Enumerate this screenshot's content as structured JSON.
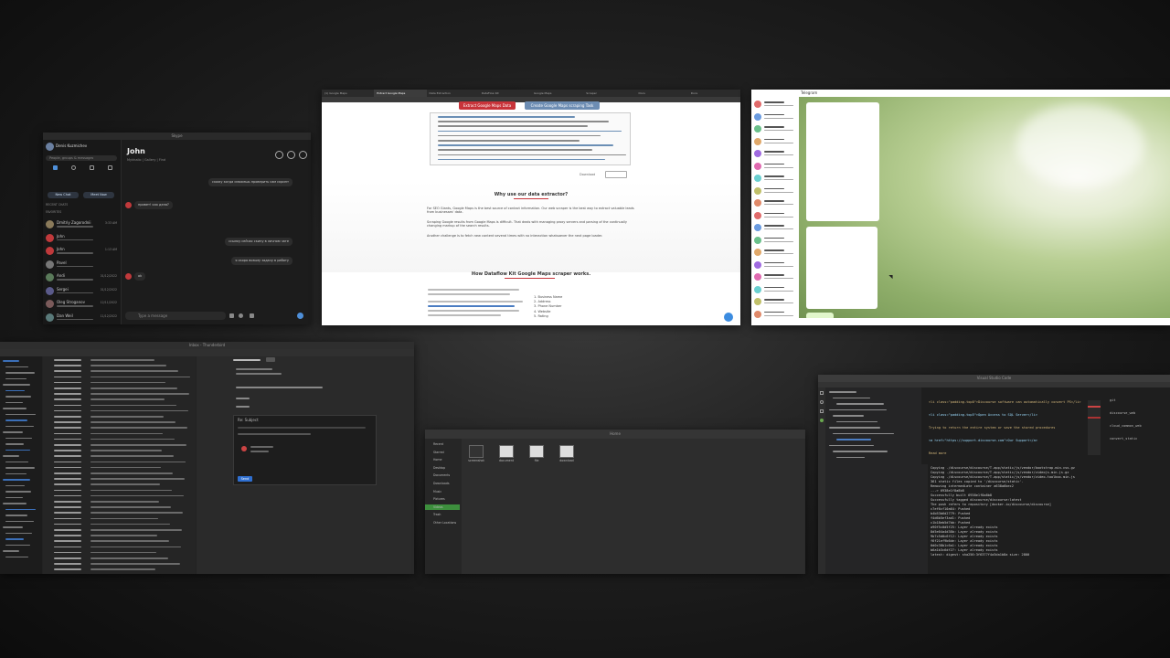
{
  "skype": {
    "title": "Skype",
    "user": "Denis Kuzmichev",
    "search_placeholder": "People, groups & messages",
    "nav": [
      "Chats",
      "Calls",
      "Contacts",
      "Notifications"
    ],
    "buttons": [
      "New Chat",
      "Meet Now"
    ],
    "section_recent": "RECENT CHATS",
    "section_favorites": "FAVORITES",
    "contacts": [
      {
        "name": "Dmitriy Zagorodnii",
        "time": "3:33 AM",
        "color": "#8a7a5a"
      },
      {
        "name": "John",
        "time": "",
        "color": "#c0393b"
      },
      {
        "name": "John",
        "time": "1:13 AM",
        "color": "#c0393b"
      },
      {
        "name": "Pavel",
        "time": "",
        "color": "#777"
      },
      {
        "name": "Andi",
        "time": "01/12/2022",
        "color": "#5a7a5a"
      },
      {
        "name": "Sergei",
        "time": "01/12/2022",
        "color": "#5a5a8a"
      },
      {
        "name": "Oleg Stroganov",
        "time": "12/11/2022",
        "color": "#7a5a5a"
      },
      {
        "name": "Dan Weil",
        "time": "11/12/2022",
        "color": "#5a7a7a"
      },
      {
        "name": "Maria",
        "time": "10/12/2022",
        "color": "#6a5a7a"
      },
      {
        "name": "DK",
        "time": "",
        "color": "#555"
      }
    ],
    "chat_title": "John",
    "chat_meta": "Mykhailo | Gallery | Find",
    "message_placeholder": "Type a message",
    "messages": [
      {
        "side": "right",
        "text": "скажу когда сможешь проверить сам скрипт"
      },
      {
        "side": "left",
        "text": "привет! как дела?"
      },
      {
        "side": "right",
        "text": "ссылку сейчас скину в личном чате"
      },
      {
        "side": "right",
        "text": "я скоро возьму задачу в работу"
      },
      {
        "side": "left",
        "text": "ok"
      }
    ]
  },
  "browser": {
    "tabs": [
      "(1) Google Maps",
      "Extract Google Maps",
      "Data Extraction",
      "DataFlow Kit",
      "Google Maps",
      "Scraper",
      "Docs",
      "Docs"
    ],
    "btn_extract": "Extract Google Maps Data",
    "btn_create": "Create Google Maps scraping Task",
    "heading1": "Why use our data extractor?",
    "heading2": "How Dataflow Kit Google Maps scraper works.",
    "paragraphs": [
      "For SEO Giants, Google Maps is the best source of contact information. Our web scraper is the best way to extract valuable leads from businesses' data.",
      "Scraping Google results from Google Maps is difficult. That deals with managing proxy servers and parsing of the continually changing markup of the search results.",
      "Another challenge is to fetch new content several times with no interaction whatsoever the next page loader."
    ],
    "features": [
      "Business Name",
      "Address",
      "Phone Number",
      "Website",
      "Rating"
    ],
    "export_label": "Download"
  },
  "telegram": {
    "title": "Telegram",
    "chats": 18
  },
  "mail": {
    "title": "Inbox - Thunderbird",
    "compose_to": "Re: Subject",
    "send_label": "Send"
  },
  "files": {
    "title": "Home",
    "sidebar": [
      "Recent",
      "Starred",
      "Home",
      "Desktop",
      "Documents",
      "Downloads",
      "Music",
      "Pictures",
      "Videos",
      "Trash",
      "Other Locations"
    ],
    "selected": "Videos",
    "items": [
      "screenshot",
      "document",
      "file",
      "download"
    ]
  },
  "vscode": {
    "title": "Visual Studio Code",
    "terminal": [
      "Copying ./discourse/discourse/T.app/static/js/vendor/bootstrap.min.css.gz",
      "Copying ./discourse/discourse/T.app/static/js/vendor/videojs.min.js.gz",
      "Copying ./discourse/discourse/T.app/static/js/vendor/video-toolbox.min.js",
      "",
      "361 static files copied to '/discourse/static'.",
      "Removing intermediate container a638a6bec2",
      " ---> 6938e1f8a8b8",
      "Successfully built 6938e1f8a8b8",
      "Successfully tagged discourse/discourse:latest",
      "The push refers to repository [docker.io/discourse/discourse]",
      "c7ef6cf10a64: Pushed",
      "b4b53b6d2779: Pushed",
      "f4d6b5ef3ad1: Pushed",
      "c1b18eb5d7bb: Pushed",
      "a90f5c0d5f25: Layer already exists",
      "8d5e04a4d38b: Layer already exists",
      "9b7c5d0c6f12: Layer already exists",
      "f6f21ef9b6de: Layer already exists",
      "0d0c38b1c6a1: Layer already exists",
      "b6a1b3c6df27: Layer already exists",
      "latest: digest: sha256:3f6377f4a3da1b8a size: 2800"
    ],
    "editor_lines": [
      "<li class=\"padding-top0\">Discourse software can automatically convert PS</li>",
      "<li class=\"padding-top5\">Open Access to SQL Server</li>",
      "Trying to return the entire system or save the stored procedures",
      "<a href=\"https://support.discourse.com\">Our Support</a>",
      "Read more"
    ],
    "right_panel": [
      "git",
      "discourse_web",
      "cloud_common_web",
      "convert_static"
    ]
  }
}
